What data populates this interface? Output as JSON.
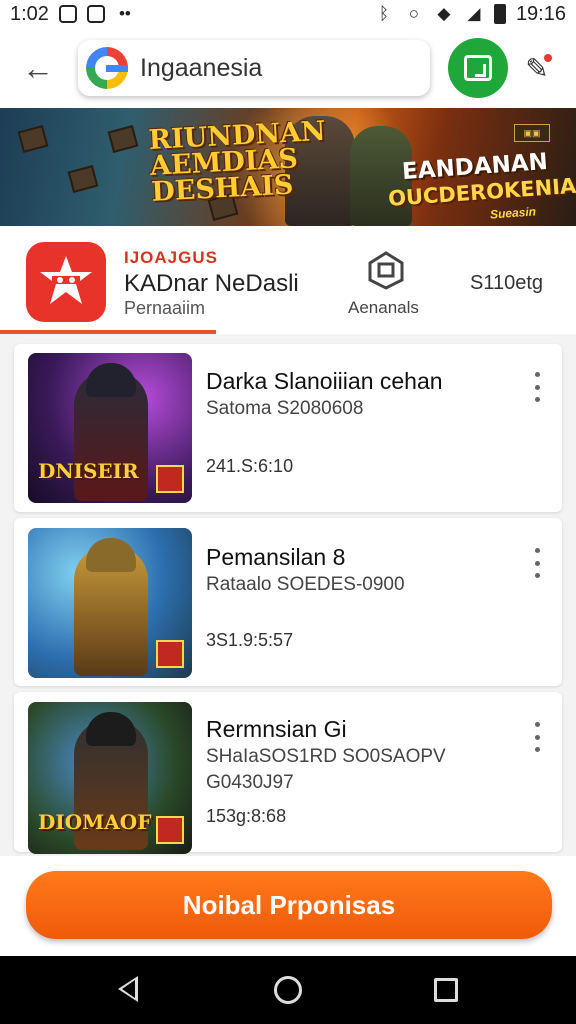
{
  "status_bar": {
    "time": "1:02",
    "clock": "19:16"
  },
  "search": {
    "query": "Ingaanesia"
  },
  "banner": {
    "title_left": "RIUNDNAN AEMDIAS DESHAIS",
    "title_right_1": "EANDANAN",
    "title_right_2": "OUCDEROKENIAI",
    "title_right_3": "Sueasin"
  },
  "app": {
    "tag": "IJOAJGUS",
    "name": "KADnar NeDasli",
    "subtitle": "Pernaaiim",
    "downloads_label": "Aenanals",
    "size_label": "S110etg"
  },
  "list": [
    {
      "title": "Darka Slanoiiian cehan",
      "subtitle": "Satoma S2080608",
      "subtitle2": "",
      "meta": "241.S:6:10",
      "thumb_label": "DNISEIR"
    },
    {
      "title": "Pemansilan 8",
      "subtitle": "Rataalo SOEDES-0900",
      "subtitle2": "",
      "meta": "3S1.9:5:57",
      "thumb_label": ""
    },
    {
      "title": "Rermnsian Gi",
      "subtitle": "SHaIaSOS1RD SO0SAOPV",
      "subtitle2": "G0430J97",
      "meta": "153g:8:68",
      "thumb_label": "DIOMAOF"
    }
  ],
  "cta": {
    "label": "Noibal Prponisas"
  },
  "colors": {
    "accent": "#f26a12",
    "brand_red": "#e8332a",
    "green": "#1fa73a"
  }
}
